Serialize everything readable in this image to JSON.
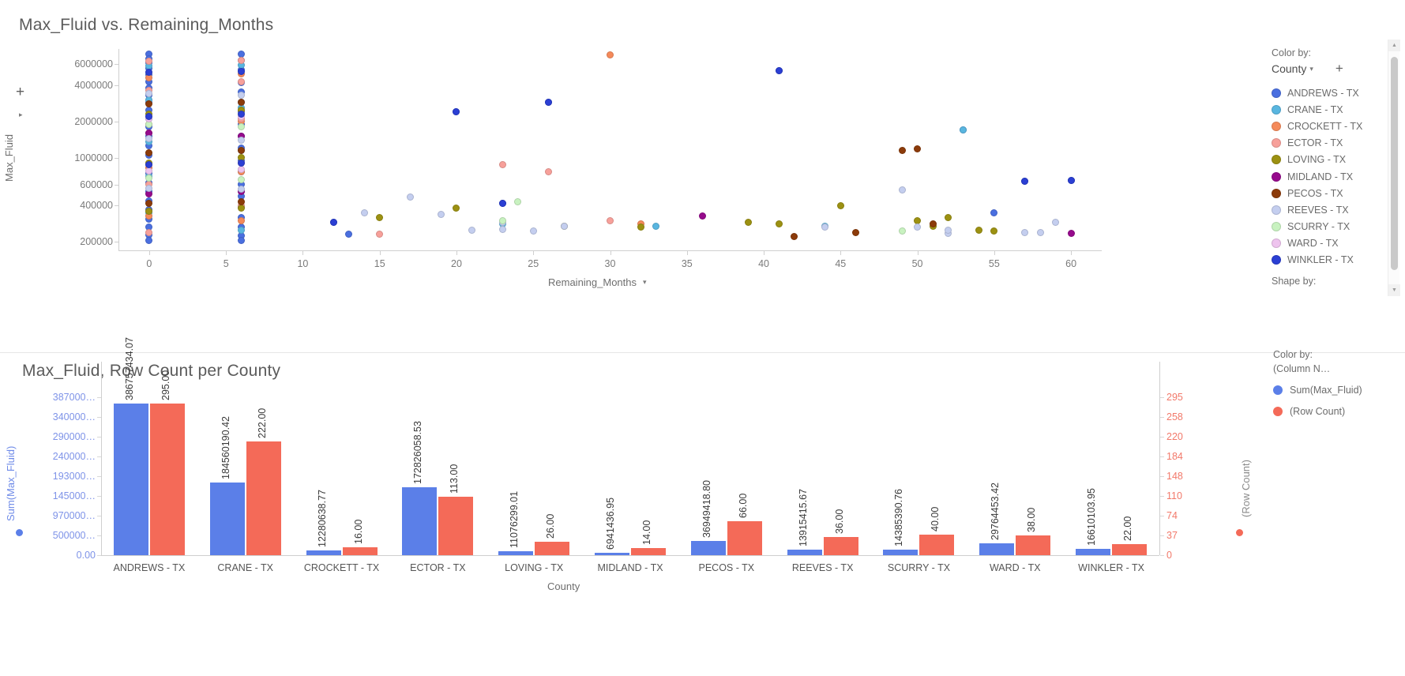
{
  "scatter": {
    "title": "Max_Fluid vs. Remaining_Months",
    "y_axis_name": "Max_Fluid",
    "x_axis_name": "Remaining_Months",
    "y_caret": "▾",
    "x_caret": "▾",
    "plus_icon": "+",
    "side_caret": "▸",
    "y_ticks": [
      "6000000",
      "4000000",
      "2000000",
      "1000000",
      "600000",
      "400000",
      "200000"
    ],
    "x_ticks": [
      "0",
      "5",
      "10",
      "15",
      "20",
      "25",
      "30",
      "35",
      "40",
      "45",
      "50",
      "55",
      "60"
    ],
    "legend": {
      "color_by_caption": "Color by:",
      "color_by_value": "County",
      "caret": "▾",
      "add_icon": "+",
      "shape_by_caption": "Shape by:",
      "items": [
        {
          "label": "ANDREWS - TX",
          "color": "#4a6fe0"
        },
        {
          "label": "CRANE - TX",
          "color": "#59b6e0"
        },
        {
          "label": "CROCKETT - TX",
          "color": "#f58a5a"
        },
        {
          "label": "ECTOR - TX",
          "color": "#f7a09a"
        },
        {
          "label": "LOVING - TX",
          "color": "#9c9112"
        },
        {
          "label": "MIDLAND - TX",
          "color": "#960a8c"
        },
        {
          "label": "PECOS - TX",
          "color": "#8c3b0a"
        },
        {
          "label": "REEVES - TX",
          "color": "#c4ceef"
        },
        {
          "label": "SCURRY - TX",
          "color": "#c8f2c0"
        },
        {
          "label": "WARD - TX",
          "color": "#eec3ee"
        },
        {
          "label": "WINKLER - TX",
          "color": "#2b3fd4"
        }
      ]
    }
  },
  "bar": {
    "title": "Max_Fluid, Row Count per County",
    "x_axis_name": "County",
    "y_left_name": "Sum(Max_Fluid)",
    "y_right_name": "(Row Count)",
    "y_left_ticks": [
      "387000…",
      "340000…",
      "290000…",
      "240000…",
      "193000…",
      "145000…",
      "970000…",
      "500000…",
      "0.00"
    ],
    "y_right_ticks": [
      "295",
      "258",
      "220",
      "184",
      "148",
      "110",
      "74",
      "37",
      "0"
    ],
    "left_color": "#5b7fe8",
    "right_color": "#f46a58",
    "legend": {
      "color_by_caption": "Color by:",
      "column_name": "(Column N…",
      "items": [
        {
          "label": "Sum(Max_Fluid)",
          "color": "#5b7fe8"
        },
        {
          "label": "(Row Count)",
          "color": "#f46a58"
        }
      ]
    }
  },
  "chart_data": [
    {
      "type": "scatter",
      "title": "Max_Fluid vs. Remaining_Months",
      "xlabel": "Remaining_Months",
      "ylabel": "Max_Fluid",
      "yscale": "log",
      "xlim": [
        -2,
        62
      ],
      "ylim": [
        170000,
        8000000
      ],
      "legend_position": "right",
      "legend_title": "County",
      "grid": false,
      "series": [
        {
          "name": "ANDREWS - TX",
          "color": "#4a6fe0",
          "points": [
            [
              0,
              7200000
            ],
            [
              0,
              6600000
            ],
            [
              0,
              6100000
            ],
            [
              0,
              5500000
            ],
            [
              0,
              4900000
            ],
            [
              0,
              4300000
            ],
            [
              0,
              3800000
            ],
            [
              0,
              3300000
            ],
            [
              0,
              2900000
            ],
            [
              0,
              2500000
            ],
            [
              0,
              2100000
            ],
            [
              0,
              1800000
            ],
            [
              0,
              1500000
            ],
            [
              0,
              1250000
            ],
            [
              0,
              1050000
            ],
            [
              0,
              880000
            ],
            [
              0,
              740000
            ],
            [
              0,
              620000
            ],
            [
              0,
              520000
            ],
            [
              0,
              440000
            ],
            [
              0,
              370000
            ],
            [
              0,
              310000
            ],
            [
              0,
              265000
            ],
            [
              0,
              228000
            ],
            [
              0,
              205000
            ],
            [
              6,
              7300000
            ],
            [
              6,
              6400000
            ],
            [
              6,
              5400000
            ],
            [
              6,
              4200000
            ],
            [
              6,
              3500000
            ],
            [
              6,
              2900000
            ],
            [
              6,
              2400000
            ],
            [
              6,
              1900000
            ],
            [
              6,
              1500000
            ],
            [
              6,
              1200000
            ],
            [
              6,
              950000
            ],
            [
              6,
              760000
            ],
            [
              6,
              600000
            ],
            [
              6,
              480000
            ],
            [
              6,
              390000
            ],
            [
              6,
              320000
            ],
            [
              6,
              265000
            ],
            [
              6,
              225000
            ],
            [
              6,
              205000
            ],
            [
              12,
              290000
            ],
            [
              20,
              2400000
            ],
            [
              23,
              420000
            ],
            [
              26,
              2900000
            ],
            [
              41,
              5300000
            ],
            [
              57,
              640000
            ],
            [
              60,
              650000
            ],
            [
              13,
              230000
            ],
            [
              55,
              350000
            ],
            [
              53,
              1700000
            ]
          ]
        },
        {
          "name": "CRANE - TX",
          "color": "#59b6e0",
          "points": [
            [
              0,
              5800000
            ],
            [
              0,
              3000000
            ],
            [
              0,
              1350000
            ],
            [
              0,
              700000
            ],
            [
              0,
              350000
            ],
            [
              6,
              5900000
            ],
            [
              6,
              2600000
            ],
            [
              6,
              1150000
            ],
            [
              6,
              520000
            ],
            [
              6,
              250000
            ],
            [
              53,
              1700000
            ],
            [
              44,
              270000
            ],
            [
              33,
              270000
            ],
            [
              23,
              280000
            ]
          ]
        },
        {
          "name": "CROCKETT - TX",
          "color": "#f58a5a",
          "points": [
            [
              0,
              4600000
            ],
            [
              0,
              1900000
            ],
            [
              0,
              820000
            ],
            [
              0,
              330000
            ],
            [
              6,
              5000000
            ],
            [
              6,
              2000000
            ],
            [
              6,
              760000
            ],
            [
              6,
              300000
            ],
            [
              30,
              7100000
            ],
            [
              32,
              280000
            ]
          ]
        },
        {
          "name": "ECTOR - TX",
          "color": "#f7a09a",
          "points": [
            [
              0,
              6300000
            ],
            [
              0,
              3600000
            ],
            [
              0,
              1600000
            ],
            [
              0,
              600000
            ],
            [
              0,
              240000
            ],
            [
              6,
              6400000
            ],
            [
              6,
              4300000
            ],
            [
              6,
              2100000
            ],
            [
              6,
              900000
            ],
            [
              6,
              400000
            ],
            [
              23,
              870000
            ],
            [
              26,
              760000
            ],
            [
              15,
              230000
            ],
            [
              30,
              300000
            ]
          ]
        },
        {
          "name": "LOVING - TX",
          "color": "#9c9112",
          "points": [
            [
              0,
              2300000
            ],
            [
              0,
              900000
            ],
            [
              0,
              360000
            ],
            [
              6,
              2500000
            ],
            [
              6,
              1000000
            ],
            [
              6,
              380000
            ],
            [
              15,
              320000
            ],
            [
              20,
              380000
            ],
            [
              27,
              270000
            ],
            [
              32,
              265000
            ],
            [
              39,
              290000
            ],
            [
              41,
              280000
            ],
            [
              50,
              300000
            ],
            [
              45,
              400000
            ],
            [
              51,
              270000
            ],
            [
              52,
              320000
            ],
            [
              54,
              250000
            ],
            [
              55,
              245000
            ]
          ]
        },
        {
          "name": "MIDLAND - TX",
          "color": "#960a8c",
          "points": [
            [
              0,
              1600000
            ],
            [
              0,
              500000
            ],
            [
              6,
              1500000
            ],
            [
              6,
              520000
            ],
            [
              36,
              330000
            ],
            [
              60,
              235000
            ]
          ]
        },
        {
          "name": "PECOS - TX",
          "color": "#8c3b0a",
          "points": [
            [
              0,
              2800000
            ],
            [
              0,
              1100000
            ],
            [
              0,
              420000
            ],
            [
              6,
              2900000
            ],
            [
              6,
              1150000
            ],
            [
              6,
              430000
            ],
            [
              49,
              1150000
            ],
            [
              50,
              1180000
            ],
            [
              42,
              220000
            ],
            [
              46,
              240000
            ],
            [
              51,
              280000
            ]
          ]
        },
        {
          "name": "REEVES - TX",
          "color": "#c4ceef",
          "points": [
            [
              0,
              3400000
            ],
            [
              0,
              1450000
            ],
            [
              0,
              560000
            ],
            [
              6,
              3300000
            ],
            [
              6,
              1400000
            ],
            [
              6,
              550000
            ],
            [
              14,
              350000
            ],
            [
              17,
              470000
            ],
            [
              19,
              340000
            ],
            [
              21,
              250000
            ],
            [
              23,
              290000
            ],
            [
              23,
              255000
            ],
            [
              25,
              245000
            ],
            [
              27,
              270000
            ],
            [
              44,
              265000
            ],
            [
              49,
              540000
            ],
            [
              50,
              265000
            ],
            [
              52,
              235000
            ],
            [
              52,
              250000
            ],
            [
              57,
              240000
            ],
            [
              58,
              240000
            ],
            [
              59,
              290000
            ]
          ]
        },
        {
          "name": "SCURRY - TX",
          "color": "#c8f2c0",
          "points": [
            [
              0,
              1900000
            ],
            [
              0,
              680000
            ],
            [
              6,
              1800000
            ],
            [
              6,
              660000
            ],
            [
              23,
              300000
            ],
            [
              24,
              430000
            ],
            [
              49,
              245000
            ]
          ]
        },
        {
          "name": "WARD - TX",
          "color": "#eec3ee",
          "points": [
            [
              0,
              2100000
            ],
            [
              0,
              780000
            ],
            [
              6,
              2200000
            ],
            [
              6,
              800000
            ]
          ]
        },
        {
          "name": "WINKLER - TX",
          "color": "#2b3fd4",
          "points": [
            [
              0,
              5100000
            ],
            [
              0,
              2200000
            ],
            [
              0,
              880000
            ],
            [
              6,
              5200000
            ],
            [
              6,
              2300000
            ],
            [
              6,
              900000
            ],
            [
              12,
              290000
            ],
            [
              20,
              2400000
            ],
            [
              26,
              2900000
            ],
            [
              41,
              5300000
            ],
            [
              57,
              640000
            ],
            [
              60,
              650000
            ],
            [
              23,
              420000
            ]
          ]
        }
      ]
    },
    {
      "type": "bar",
      "title": "Max_Fluid, Row Count per County",
      "xlabel": "County",
      "ylabel": "Sum(Max_Fluid)",
      "y2label": "(Row Count)",
      "grid": false,
      "legend_position": "right",
      "categories": [
        "ANDREWS - TX",
        "CRANE - TX",
        "CROCKETT - TX",
        "ECTOR - TX",
        "LOVING - TX",
        "MIDLAND - TX",
        "PECOS - TX",
        "REEVES - TX",
        "SCURRY - TX",
        "WARD - TX",
        "WINKLER - TX"
      ],
      "ylim": [
        0,
        387000000
      ],
      "y2lim": [
        0,
        295
      ],
      "series": [
        {
          "name": "Sum(Max_Fluid)",
          "color": "#5b7fe8",
          "axis": "left",
          "values": [
            386757434.07,
            184560190.42,
            12280638.77,
            172826058.53,
            11076299.01,
            6941436.95,
            36949418.8,
            13915415.67,
            14385390.76,
            29764453.42,
            16610103.95
          ],
          "labels": [
            "386757434.07",
            "184560190.42",
            "12280638.77",
            "172826058.53",
            "11076299.01",
            "6941436.95",
            "36949418.80",
            "13915415.67",
            "14385390.76",
            "29764453.42",
            "16610103.95"
          ]
        },
        {
          "name": "(Row Count)",
          "color": "#f46a58",
          "axis": "right",
          "values": [
            295,
            222,
            16,
            113,
            26,
            14,
            66,
            36,
            40,
            38,
            22
          ],
          "labels": [
            "295.00",
            "222.00",
            "16.00",
            "113.00",
            "26.00",
            "14.00",
            "66.00",
            "36.00",
            "40.00",
            "38.00",
            "22.00"
          ]
        }
      ]
    }
  ]
}
